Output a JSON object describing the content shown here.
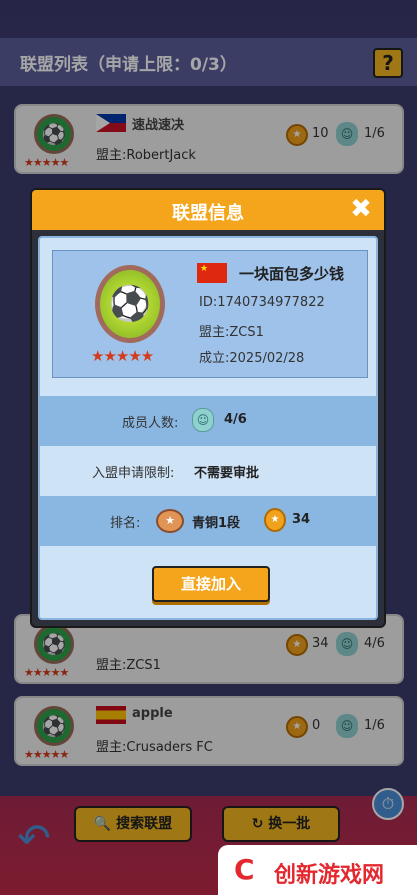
{
  "header": {
    "title": "联盟列表（申请上限：0/3）",
    "help_label": "?"
  },
  "list": [
    {
      "flag": "PH",
      "name": "速战速决",
      "leader": "盟主:RobertJack",
      "medal": "10",
      "members": "1/6"
    },
    {
      "flag": "CN",
      "name": "一块面包多少钱",
      "leader": "盟主:ZCS1",
      "medal": "34",
      "members": "4/6"
    },
    {
      "flag": "ES",
      "name": "apple",
      "leader": "盟主:Crusaders FC",
      "medal": "0",
      "members": "1/6"
    }
  ],
  "buttons": {
    "search": "搜索联盟",
    "refresh": "换一批"
  },
  "dialog": {
    "title": "联盟信息",
    "name": "一块面包多少钱",
    "id": "ID:1740734977822",
    "leader": "盟主:ZCS1",
    "founded": "成立:2025/02/28",
    "members_label": "成员人数:",
    "members_value": "4/6",
    "join_limit_label": "入盟申请限制:",
    "join_limit_value": "不需要审批",
    "rank_label": "排名:",
    "rank_value": "青铜1段",
    "rank_points": "34",
    "join_button": "直接加入"
  },
  "watermark": {
    "text": "创新游戏网"
  },
  "colors": {
    "accent": "#f4a51c",
    "panel": "#cfe3f7",
    "stars": "#d43a1c"
  }
}
